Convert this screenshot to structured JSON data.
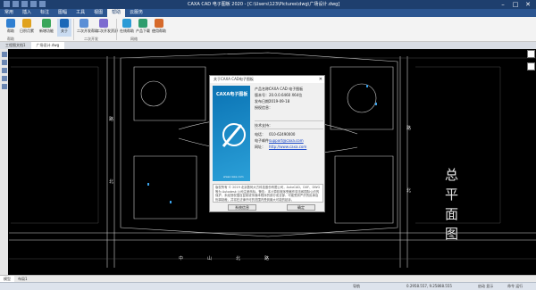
{
  "app": {
    "title": "CAXA CAD 电子图板 2020 - [C:\\Users\\123\\Pictures\\dwg\\广场设计.dwg]"
  },
  "window": {
    "minimize": "–",
    "maximize": "□",
    "close": "✕"
  },
  "menu": {
    "tabs": [
      "常用",
      "插入",
      "标注",
      "图幅",
      "工具",
      "视图",
      "帮助",
      "云服务"
    ],
    "active": "帮助"
  },
  "ribbon": {
    "buttons": [
      "帮助",
      "日积月累",
      "新增功能",
      "关于",
      "二次开发帮助",
      "二次开发资源",
      "在线帮助",
      "产品下载",
      "使用帮助"
    ],
    "groups": [
      "帮助",
      "二次开发",
      "网络"
    ]
  },
  "doc_tabs": [
    "工程图文档1",
    "广场设计.dwg"
  ],
  "drawing": {
    "big_text": [
      "总",
      "平",
      "面",
      "图"
    ],
    "road_bottom": [
      "中",
      "山",
      "北",
      "路"
    ],
    "road_right": [
      "路",
      "北"
    ],
    "road_left": [
      "路",
      "北"
    ]
  },
  "about_dialog": {
    "title": "关于CAXA CAD电子图板",
    "close": "✕",
    "splash_logo": "CAXA电子图板",
    "splash_url": "www.caxa.com",
    "rows": [
      {
        "label": "产品名称：",
        "value": "CAXA CAD 电子图板"
      },
      {
        "label": "版本号：",
        "value": "20.0.0.6460 X64位"
      },
      {
        "label": "发布日期：",
        "value": "2019-09-18"
      },
      {
        "label": "授权信息：",
        "value": ""
      }
    ],
    "support_heading": "技术支持：",
    "contact_rows": [
      {
        "label": "电话：",
        "value": "010-62490000"
      },
      {
        "label": "电子邮件：",
        "value": "support@caxa.com"
      },
      {
        "label": "网址：",
        "value": "http://www.caxa.com"
      }
    ],
    "legal": "版权所有 © 2019 北京数码大方科技股份有限公司，AutoCAD、DXF、DWG 等为 Autodesk 公司注册商标。警告：本计算机程序受著作权法和国际公约的保护，未经授权擅自复制或传播本程序的部分或全部，可能受到严厉的民事及刑事制裁，并将在法律许可的范围内受到最大可能的起诉。",
    "buttons": {
      "sysinfo": "系统信息",
      "ok": "确定"
    }
  },
  "layout_tabs": [
    "模型",
    "布局1"
  ],
  "status": {
    "coords": "0.2958.557, 9.25868.555",
    "mode": "导航",
    "mode2": "启动 显示",
    "right": "命令 运行"
  }
}
